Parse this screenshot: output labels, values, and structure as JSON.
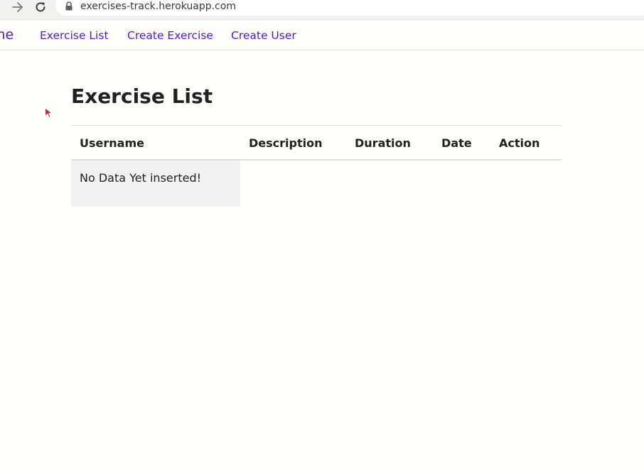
{
  "browser": {
    "url": "exercises-track.herokuapp.com"
  },
  "navbar": {
    "brand_partial": "me",
    "links": [
      {
        "label": "Exercise List"
      },
      {
        "label": "Create Exercise"
      },
      {
        "label": "Create User"
      }
    ]
  },
  "main": {
    "title": "Exercise List",
    "table": {
      "columns": [
        "Username",
        "Description",
        "Duration",
        "Date",
        "Action"
      ],
      "empty_message": "No Data Yet inserted!"
    }
  },
  "colors": {
    "link": "#5a16c8",
    "background": "#fffffc",
    "empty_cell": "#f1f1ef",
    "text": "#212121"
  },
  "icons": {
    "forward": "arrow-right-icon",
    "reload": "reload-icon",
    "lock": "lock-icon",
    "cursor": "mouse-pointer-icon"
  }
}
